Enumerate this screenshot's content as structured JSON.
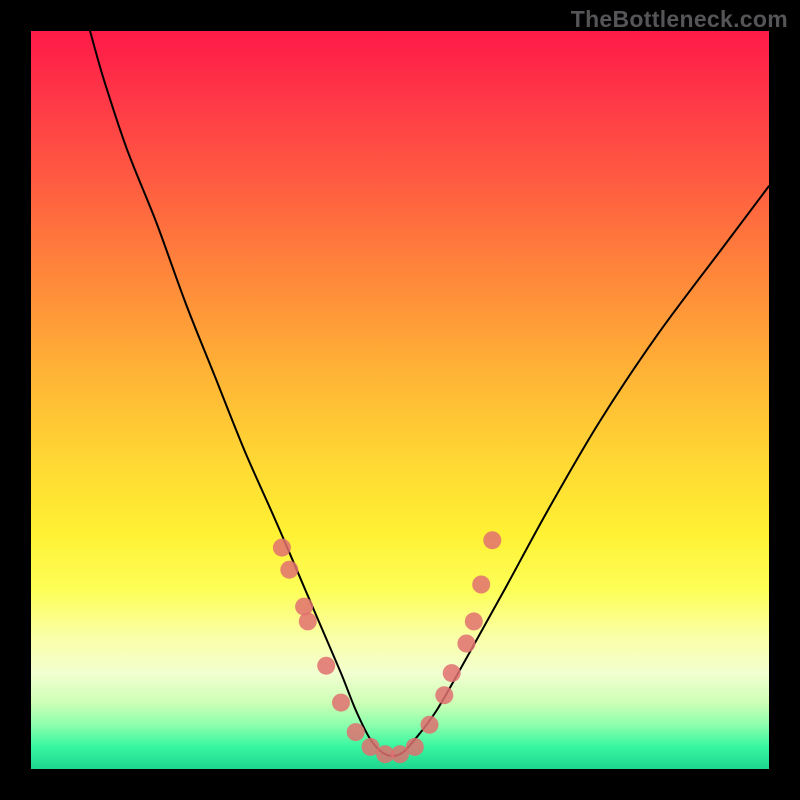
{
  "watermark": "TheBottleneck.com",
  "colors": {
    "frame": "#000000",
    "curve_stroke": "#000000",
    "marker_fill": "#e07070",
    "gradient_top": "#ff1a47",
    "gradient_bottom": "#1dd68f"
  },
  "chart_data": {
    "type": "line",
    "title": "",
    "xlabel": "",
    "ylabel": "",
    "xlim": [
      0,
      100
    ],
    "ylim": [
      0,
      100
    ],
    "note": "Axes are unlabeled; x/y values are normalized to 0-100 of plot area. y=100 is top (red, bad fit); y=0 is bottom (green, best fit). Curve forms a V with minimum near x≈48.",
    "series": [
      {
        "name": "bottleneck-curve",
        "x": [
          8,
          10,
          13,
          17,
          21,
          25,
          29,
          33,
          36,
          39,
          42,
          44,
          46,
          48,
          50,
          52,
          55,
          59,
          64,
          70,
          77,
          85,
          94,
          100
        ],
        "y": [
          100,
          93,
          84,
          74,
          63,
          53,
          43,
          34,
          27,
          20,
          13,
          8,
          4,
          2,
          2,
          4,
          8,
          15,
          24,
          35,
          47,
          59,
          71,
          79
        ]
      }
    ],
    "markers": {
      "name": "highlighted-points",
      "x": [
        34,
        35,
        37,
        37.5,
        40,
        42,
        44,
        46,
        48,
        50,
        52,
        54,
        56,
        57,
        59,
        60,
        61,
        62.5
      ],
      "y": [
        30,
        27,
        22,
        20,
        14,
        9,
        5,
        3,
        2,
        2,
        3,
        6,
        10,
        13,
        17,
        20,
        25,
        31
      ]
    }
  }
}
